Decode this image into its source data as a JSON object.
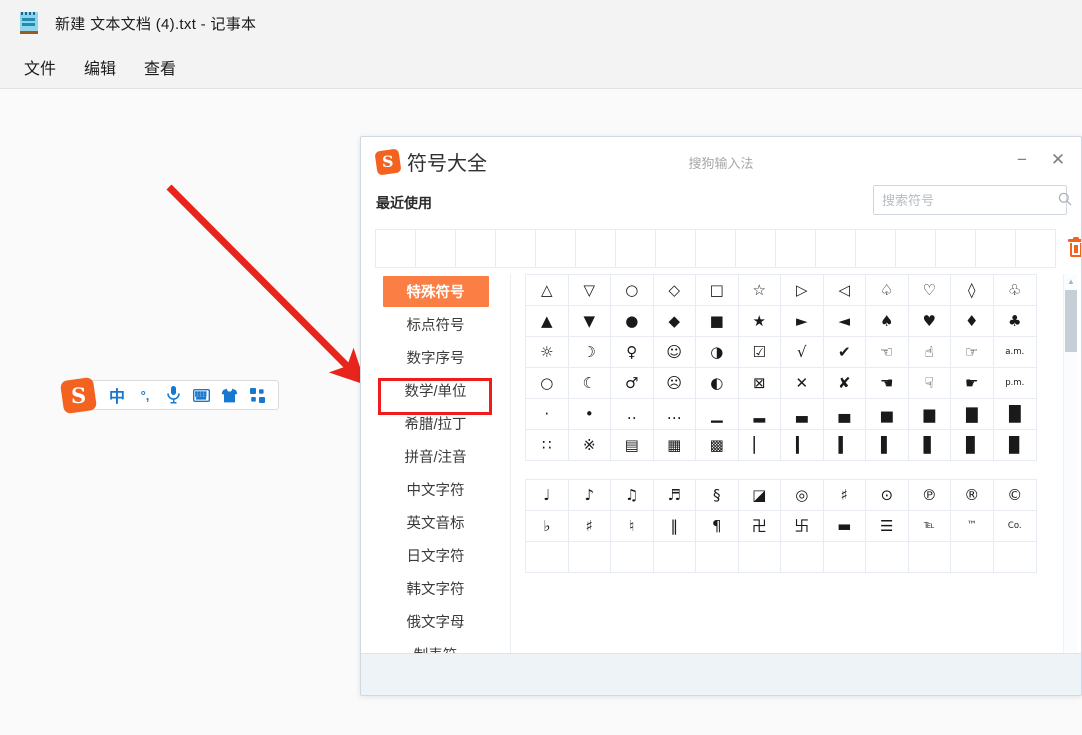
{
  "notepad": {
    "icon": "notepad-icon",
    "title": "新建 文本文档 (4).txt - 记事本",
    "menu": [
      "文件",
      "编辑",
      "查看"
    ]
  },
  "sogou_toolbar": {
    "logo": "sogou-s-logo",
    "buttons": [
      {
        "name": "chinese-mode-button",
        "glyph": "中"
      },
      {
        "name": "punctuation-button",
        "glyph": "°,"
      },
      {
        "name": "voice-input-button",
        "glyph": "🎤"
      },
      {
        "name": "soft-keyboard-button",
        "glyph": "⌨"
      },
      {
        "name": "skin-button",
        "glyph": "👕"
      },
      {
        "name": "toolbox-button",
        "glyph": "▦"
      }
    ]
  },
  "annotation": {
    "arrow_color": "#e8251c",
    "highlight_color": "#f01b1b",
    "highlight_target": "数学/单位"
  },
  "symbol_window": {
    "brand_logo": "sogou-s-logo",
    "brand_title": "符号大全",
    "subtitle": "搜狗输入法",
    "minimize_label": "−",
    "close_label": "✕",
    "recent_label": "最近使用",
    "recent_cell_count": 17,
    "clear_recent": "trash-icon",
    "search": {
      "placeholder": "搜索符号",
      "value": "",
      "icon": "search-icon"
    },
    "categories": [
      {
        "label": "特殊符号",
        "active": true
      },
      {
        "label": "标点符号",
        "active": false
      },
      {
        "label": "数字序号",
        "active": false
      },
      {
        "label": "数学/单位",
        "active": false,
        "highlighted": true
      },
      {
        "label": "希腊/拉丁",
        "active": false
      },
      {
        "label": "拼音/注音",
        "active": false
      },
      {
        "label": "中文字符",
        "active": false
      },
      {
        "label": "英文音标",
        "active": false
      },
      {
        "label": "日文字符",
        "active": false
      },
      {
        "label": "韩文字符",
        "active": false
      },
      {
        "label": "俄文字母",
        "active": false
      },
      {
        "label": "制表符",
        "active": false
      }
    ],
    "sections": [
      {
        "rows": [
          [
            "△",
            "▽",
            "○",
            "◇",
            "□",
            "☆",
            "▷",
            "◁",
            "♤",
            "♡",
            "◊",
            "♧"
          ],
          [
            "▲",
            "▼",
            "●",
            "◆",
            "■",
            "★",
            "►",
            "◄",
            "♠",
            "♥",
            "♦",
            "♣"
          ],
          [
            "☼",
            "☽",
            "♀",
            "☺",
            "◑",
            "☑",
            "√",
            "✔",
            "☜",
            "☝",
            "☞",
            "a.m."
          ],
          [
            "○",
            "☾",
            "♂",
            "☹",
            "◐",
            "⊠",
            "✕",
            "✘",
            "☚",
            "☟",
            "☛",
            "p.m."
          ],
          [
            "·",
            "•",
            "‥",
            "…",
            "▁",
            "▂",
            "▃",
            "▄",
            "▅",
            "▆",
            "▇",
            "█"
          ],
          [
            "∷",
            "※",
            "▤",
            "▦",
            "▩",
            "▏",
            "▎",
            "▍",
            "▌",
            "▋",
            "▊",
            "▉"
          ]
        ]
      },
      {
        "rows": [
          [
            "♩",
            "♪",
            "♫",
            "♬",
            "§",
            "◪",
            "◎",
            "♯",
            "⊙",
            "℗",
            "®",
            "©"
          ],
          [
            "♭",
            "♯",
            "♮",
            "‖",
            "¶",
            "卍",
            "卐",
            "▬",
            "☰",
            "℡",
            "™",
            "Co."
          ],
          [
            "",
            "",
            "",
            "",
            "",
            "",
            "",
            "",
            "",
            "",
            "",
            ""
          ]
        ]
      }
    ],
    "scrollbar": {
      "up_arrow": "▲",
      "down_arrow": "▼"
    }
  }
}
